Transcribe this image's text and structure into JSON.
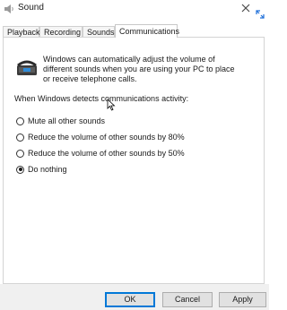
{
  "window": {
    "title": "Sound"
  },
  "tabs": [
    {
      "label": "Playback",
      "active": false
    },
    {
      "label": "Recording",
      "active": false
    },
    {
      "label": "Sounds",
      "active": false
    },
    {
      "label": "Communications",
      "active": true
    }
  ],
  "communications": {
    "info": "Windows can automatically adjust the volume of different sounds when you are using your PC to place or receive telephone calls.",
    "prompt": "When Windows detects communications activity:",
    "options": [
      {
        "label": "Mute all other sounds",
        "checked": false
      },
      {
        "label": "Reduce the volume of other sounds by 80%",
        "checked": false
      },
      {
        "label": "Reduce the volume of other sounds by 50%",
        "checked": false
      },
      {
        "label": "Do nothing",
        "checked": true
      }
    ]
  },
  "buttons": {
    "ok": "OK",
    "cancel": "Cancel",
    "apply": "Apply"
  },
  "icons": {
    "app": "speaker-icon",
    "close": "close-icon",
    "expand": "expand-icon",
    "phone": "telephone-icon"
  }
}
